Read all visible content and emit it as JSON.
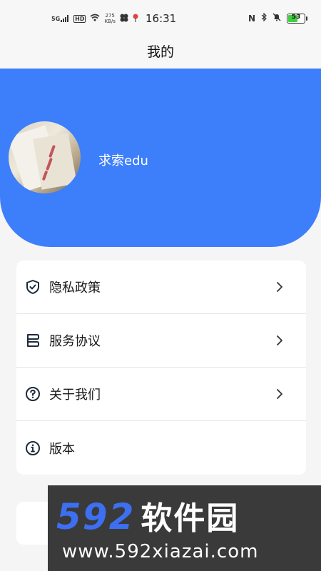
{
  "status_bar": {
    "network": "5G",
    "hd": "HD",
    "speed_value": "275",
    "speed_unit": "KB/s",
    "time": "16:31",
    "battery": "53",
    "icons": [
      "signal-icon",
      "hd-icon",
      "wifi-icon",
      "app-icon",
      "location-icon",
      "nfc-icon",
      "bluetooth-icon",
      "mute-icon",
      "battery-icon"
    ]
  },
  "header": {
    "title": "我的"
  },
  "profile": {
    "name": "求索edu",
    "background_color": "#3d7efb"
  },
  "menu": {
    "items": [
      {
        "label": "隐私政策",
        "icon": "shield-icon",
        "has_arrow": true
      },
      {
        "label": "服务协议",
        "icon": "agreement-icon",
        "has_arrow": true
      },
      {
        "label": "关于我们",
        "icon": "question-icon",
        "has_arrow": true
      },
      {
        "label": "版本",
        "icon": "info-icon",
        "has_arrow": false
      }
    ]
  },
  "watermark": {
    "logo_digits": "592",
    "logo_text": "软件园",
    "url": "www.592xiazai.com"
  }
}
